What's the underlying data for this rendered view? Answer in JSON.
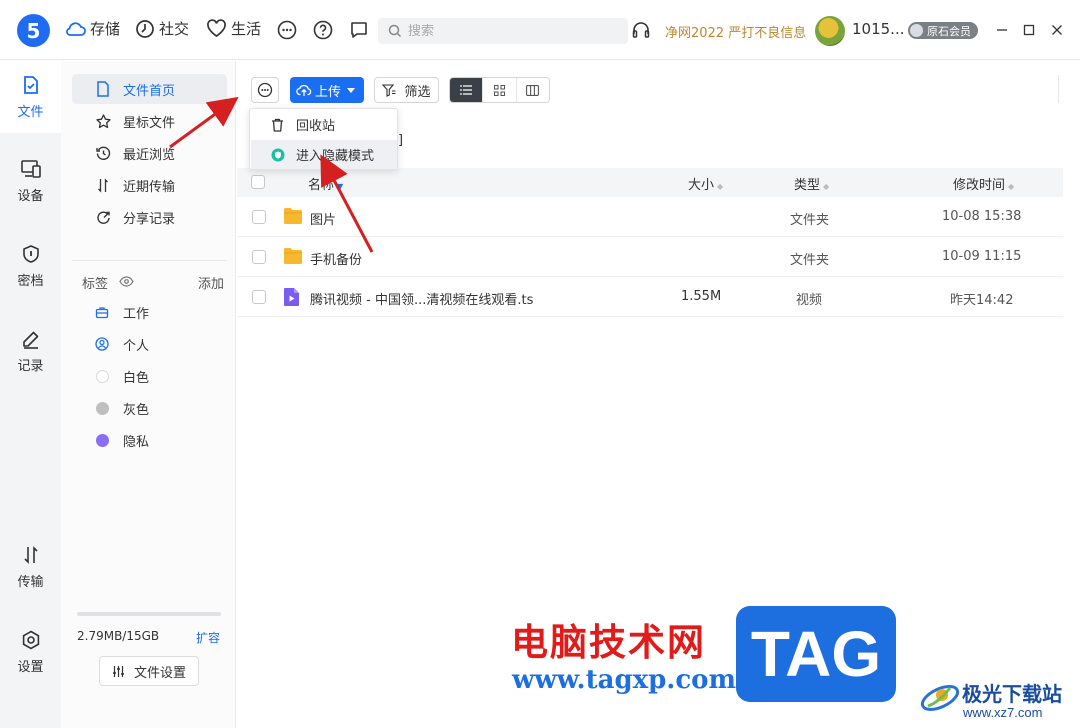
{
  "app": {
    "logo_text": "5",
    "top_nav": [
      {
        "label": "存储",
        "icon": "cloud-icon"
      },
      {
        "label": "社交",
        "icon": "clock-icon"
      },
      {
        "label": "生活",
        "icon": "heart-icon"
      }
    ],
    "search_placeholder": "搜索",
    "promo": "净网2022 严打不良信息",
    "username": "1015...",
    "member_badge": "原石会员"
  },
  "rail": [
    {
      "label": "文件",
      "icon": "file-icon",
      "active": true
    },
    {
      "label": "设备",
      "icon": "device-icon"
    },
    {
      "label": "密档",
      "icon": "shield-icon"
    },
    {
      "label": "记录",
      "icon": "pen-icon"
    },
    {
      "label": "传输",
      "icon": "transfer-icon"
    },
    {
      "label": "设置",
      "icon": "gear-icon"
    }
  ],
  "sidebar": {
    "items": [
      {
        "label": "文件首页",
        "icon": "document-icon",
        "active": true
      },
      {
        "label": "星标文件",
        "icon": "star-icon"
      },
      {
        "label": "最近浏览",
        "icon": "history-icon"
      },
      {
        "label": "近期传输",
        "icon": "transfer-icon"
      },
      {
        "label": "分享记录",
        "icon": "share-icon"
      }
    ],
    "tags_title": "标签",
    "tags_add": "添加",
    "tags": [
      {
        "label": "工作",
        "icon": "briefcase-icon"
      },
      {
        "label": "个人",
        "icon": "person-icon"
      },
      {
        "label": "白色",
        "color": "#ffffff"
      },
      {
        "label": "灰色",
        "color": "#bfbfbf"
      },
      {
        "label": "隐私",
        "color": "#8b6cf5"
      }
    ],
    "quota": "2.79MB/15GB",
    "quota_fraction": 0.0002,
    "expand": "扩容",
    "settings_button": "文件设置"
  },
  "toolbar": {
    "upload": "上传",
    "filter": "筛选"
  },
  "menu": {
    "items": [
      {
        "label": "回收站",
        "icon": "trash-icon"
      },
      {
        "label": "进入隐藏模式",
        "icon": "hidden-mode-icon"
      }
    ]
  },
  "crumb_fragment": "]",
  "table": {
    "columns": {
      "name": "名称",
      "size": "大小",
      "type": "类型",
      "modified": "修改时间"
    },
    "rows": [
      {
        "name": "图片",
        "size": "",
        "type": "文件夹",
        "modified": "10-08 15:38",
        "kind": "folder"
      },
      {
        "name": "手机备份",
        "size": "",
        "type": "文件夹",
        "modified": "10-09 11:15",
        "kind": "folder"
      },
      {
        "name": "腾讯视频 - 中国领...清视频在线观看.ts",
        "size": "1.55M",
        "type": "视频",
        "modified": "昨天14:42",
        "kind": "video"
      }
    ]
  },
  "watermark": {
    "title": "电脑技术网",
    "url": "www.tagxp.com",
    "tag": "TAG",
    "site_name": "极光下载站",
    "site_url": "www.xz7.com"
  },
  "colors": {
    "accent": "#1a6ef2",
    "folder": "#f5b82e",
    "video": "#7a5cf0",
    "arrow": "#d42020",
    "promo": "#c0872e"
  }
}
